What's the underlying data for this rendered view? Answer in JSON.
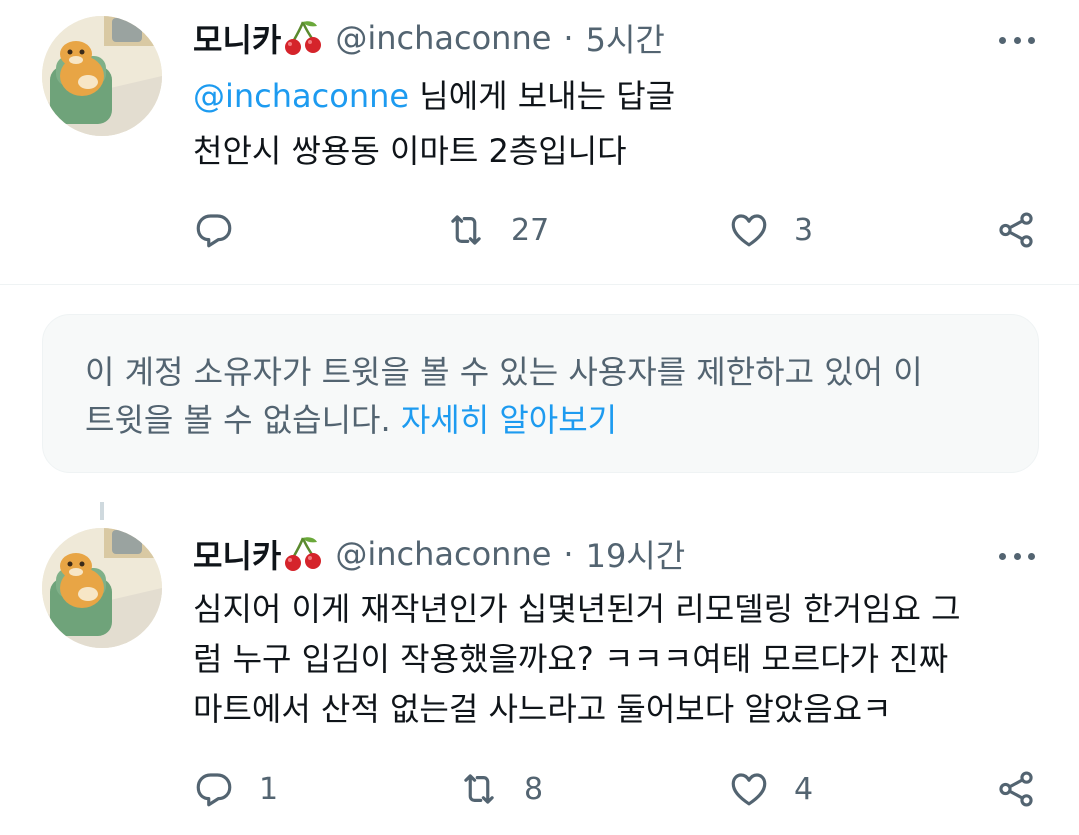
{
  "tweets": [
    {
      "name": "모니카",
      "handle": "@inchaconne",
      "separator": "·",
      "time": "5시간",
      "reply_to_handle": "@inchaconne",
      "reply_to_suffix": " 님에게 보내는 답글",
      "lines": [
        "천안시 쌍용동 이마트 2층입니다"
      ],
      "reply_count": "",
      "retweet_count": "27",
      "like_count": "3"
    },
    {
      "name": "모니카",
      "handle": "@inchaconne",
      "separator": "·",
      "time": "19시간",
      "lines": [
        "심지어 이게 재작년인가 십몇년된거 리모델링 한거임요 그",
        "럼 누구 입김이 작용했을까요? ㅋㅋㅋ여태 모르다가 진짜",
        "마트에서 산적 없는걸 사느라고 둘어보다 알았음요ㅋ"
      ],
      "reply_count": "1",
      "retweet_count": "8",
      "like_count": "4"
    }
  ],
  "notice": {
    "line1": "이 계정 소유자가 트윗을 볼 수 있는 사용자를 제한하고 있어 이",
    "line2": "트윗을 볼 수 없습니다.",
    "link": "자세히 알아보기"
  },
  "icons": {
    "name_emoji": "cherry-icon",
    "more": "more-options-icon",
    "reply": "reply-icon",
    "retweet": "retweet-icon",
    "like": "like-icon",
    "share": "share-icon"
  },
  "colors": {
    "text": "#0f1419",
    "secondary": "#536471",
    "link": "#1d9bf0",
    "notice_bg": "#f7f9f9",
    "divider": "#eff3f4"
  }
}
